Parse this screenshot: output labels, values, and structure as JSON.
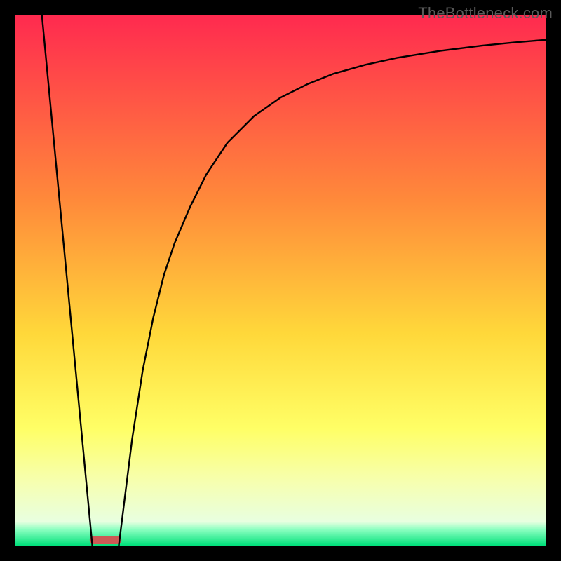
{
  "watermark": "TheBottleneck.com",
  "chart_data": {
    "type": "line",
    "title": "",
    "xlabel": "",
    "ylabel": "",
    "xlim": [
      0,
      100
    ],
    "ylim": [
      0,
      100
    ],
    "grid": false,
    "background_gradient": {
      "stops": [
        {
          "offset": 0.0,
          "color": "#ff2a4f"
        },
        {
          "offset": 0.35,
          "color": "#ff8a3a"
        },
        {
          "offset": 0.6,
          "color": "#ffd83a"
        },
        {
          "offset": 0.78,
          "color": "#ffff66"
        },
        {
          "offset": 0.88,
          "color": "#f6ffb0"
        },
        {
          "offset": 0.955,
          "color": "#e8ffe0"
        },
        {
          "offset": 0.97,
          "color": "#8affc0"
        },
        {
          "offset": 1.0,
          "color": "#00e07a"
        }
      ]
    },
    "marker": {
      "x_center": 17,
      "y": 0,
      "width": 6,
      "color": "#cc5a55"
    },
    "series": [
      {
        "name": "left-leg",
        "x": [
          5,
          14.5
        ],
        "y": [
          100,
          0
        ],
        "color": "#000000"
      },
      {
        "name": "right-curve",
        "x": [
          19.5,
          22,
          24,
          26,
          28,
          30,
          33,
          36,
          40,
          45,
          50,
          55,
          60,
          66,
          72,
          80,
          88,
          94,
          100
        ],
        "y": [
          0,
          20,
          33,
          43,
          51,
          57,
          64,
          70,
          76,
          81,
          84.5,
          87,
          89,
          90.7,
          92,
          93.3,
          94.3,
          94.9,
          95.4
        ],
        "color": "#000000"
      }
    ]
  }
}
